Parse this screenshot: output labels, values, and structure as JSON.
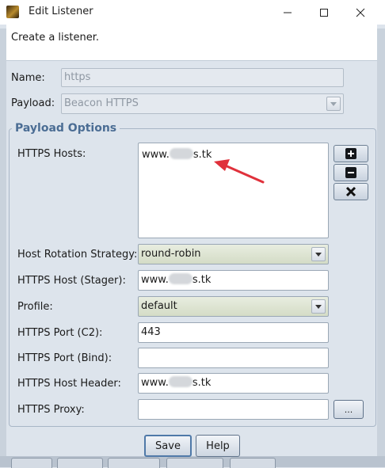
{
  "window": {
    "title": "Edit Listener"
  },
  "banner": {
    "text": "Create a listener."
  },
  "form": {
    "name_label": "Name:",
    "name_value": "https",
    "payload_label": "Payload:",
    "payload_value": "Beacon HTTPS"
  },
  "options": {
    "group_title": "Payload Options",
    "https_hosts_label": "HTTPS Hosts:",
    "https_hosts_value_prefix": "www.",
    "https_hosts_value_suffix": "s.tk",
    "rotation_label": "Host Rotation Strategy:",
    "rotation_value": "round-robin",
    "stager_label": "HTTPS Host (Stager):",
    "stager_prefix": "www.",
    "stager_suffix": "s.tk",
    "profile_label": "Profile:",
    "profile_value": "default",
    "port_c2_label": "HTTPS Port (C2):",
    "port_c2_value": "443",
    "port_bind_label": "HTTPS Port (Bind):",
    "port_bind_value": "",
    "host_header_label": "HTTPS Host Header:",
    "host_header_prefix": "www.",
    "host_header_suffix": "s.tk",
    "proxy_label": "HTTPS Proxy:",
    "proxy_value": "",
    "proxy_button": "..."
  },
  "buttons": {
    "save": "Save",
    "help": "Help"
  },
  "colors": {
    "annotation_arrow": "#e0313b",
    "group_title": "#4b6d94"
  }
}
